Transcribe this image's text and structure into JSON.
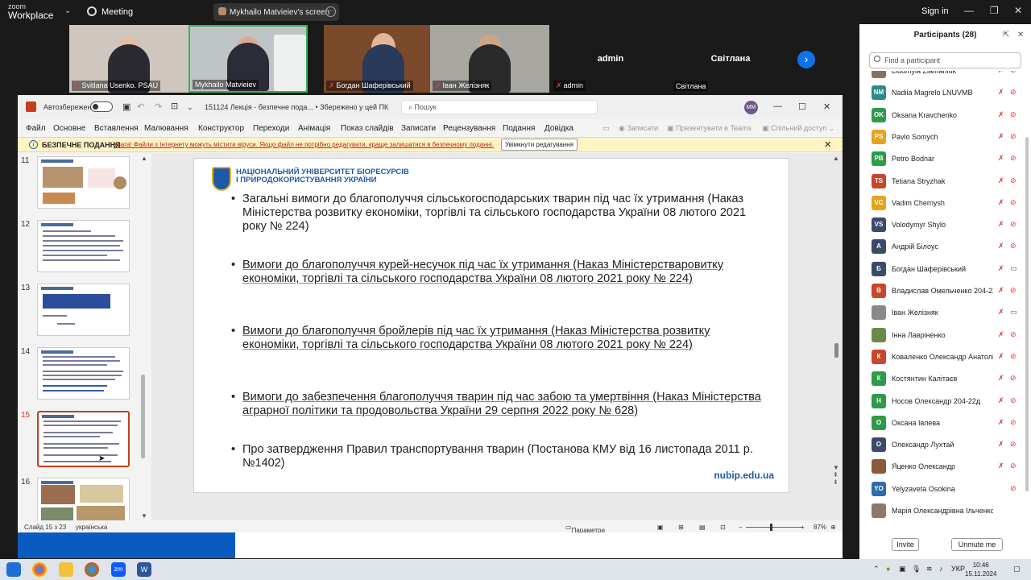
{
  "zoom": {
    "logo_top": "zoom",
    "logo_bottom": "Workplace",
    "meeting_label": "Meeting",
    "screen_label": "Mykhailo Matvieiev's screen",
    "signin": "Sign in"
  },
  "gallery": [
    {
      "name": "Svitlana Usenko. PSAU",
      "tile_text": ""
    },
    {
      "name": "Mykhailo Matvieiev",
      "tile_text": ""
    },
    {
      "name": "Богдан Шаферівський",
      "tile_text": ""
    },
    {
      "name": "Іван Желізняк",
      "tile_text": ""
    },
    {
      "name": "admin",
      "tile_text": "admin"
    },
    {
      "name": "Світлана",
      "tile_text": "Світлана"
    }
  ],
  "ppt": {
    "autosave_label": "Автозбереження",
    "doc_title": "151124 Лекція - безпечне пода...",
    "saved_label": "• Збережено у цей ПК",
    "search_placeholder": "Пошук",
    "user_initials": "MM",
    "menu": [
      "Файл",
      "Основне",
      "Вставлення",
      "Малювання",
      "Конструктор",
      "Переходи",
      "Анімація",
      "Показ слайдів",
      "Записати",
      "Рецензування",
      "Подання",
      "Довідка"
    ],
    "menu_right": [
      "Записати",
      "Презентувати в Teams",
      "Спільний доступ"
    ],
    "protected_title": "БЕЗПЕЧНЕ ПОДАННЯ",
    "protected_msg": "Увага! Файли з Інтернету можуть містити віруси. Якщо файл не потрібно редагувати, краще залишатися в безпечному поданні.",
    "enable_edit": "Увімкнути редагування",
    "thumbnails": [
      "11",
      "12",
      "13",
      "14",
      "15",
      "16"
    ],
    "selected_slide": "15",
    "slide": {
      "university": [
        "НАЦІОНАЛЬНИЙ УНІВЕРСИТЕТ БІОРЕСУРСІВ",
        "І ПРИРОДОКОРИСТУВАННЯ УКРАЇНИ"
      ],
      "bullets": [
        "Загальні вимоги до благополуччя сільськогосподарських тварин під час їх утримання (Наказ Міністерства розвитку економіки, торгівлі та сільського господарства України 08 лютого 2021 року № 224)",
        "Вимоги до благополуччя курей-несучок під час їх утримання (Наказ Міністерстваровитку економіки, торгівлі та сільського господарства України 08 лютого 2021 року № 224)",
        "Вимоги до благополуччя бройлерів під час їх утримання (Наказ Міністерства розвитку економіки, торгівлі та сільського господарства України 08 лютого 2021 року № 224)",
        "Вимоги до забезпечення благополуччя тварин під час забою та умертвіння (Наказ Міністерства аграрної політики та продовольства України 29 серпня 2022 року № 628)",
        "Про затвердження Правил транспортування тварин (Постанова КМУ від 16 листопада 2011 р. №1402)"
      ],
      "site": "nubip.edu.ua"
    },
    "status_slide": "Слайд 15 з 23",
    "status_lang": "українська",
    "status_view": "Параметри відображення",
    "zoom_level": "87%"
  },
  "participants": {
    "title": "Participants (28)",
    "search_placeholder": "Find a participant",
    "list": [
      {
        "name": "Liudmyla Ziamaniuk",
        "initials": "",
        "color": "#8a6f5a",
        "cam_on": false
      },
      {
        "name": "Nadiia Magrelo LNUVMB",
        "initials": "NM",
        "color": "#2e8a8a",
        "cam_on": false
      },
      {
        "name": "Oksana Kravchenko",
        "initials": "OK",
        "color": "#2e9a4a",
        "cam_on": false
      },
      {
        "name": "Pavlo Somych",
        "initials": "PS",
        "color": "#e8a21a",
        "cam_on": false
      },
      {
        "name": "Petro Bodnar",
        "initials": "PB",
        "color": "#2e9a4a",
        "cam_on": false
      },
      {
        "name": "Tetiana Stryzhak",
        "initials": "TS",
        "color": "#c8462a",
        "cam_on": false
      },
      {
        "name": "Vadim Chernysh",
        "initials": "VC",
        "color": "#e8a21a",
        "cam_on": false
      },
      {
        "name": "Volodymyr Shylo",
        "initials": "VS",
        "color": "#3a4a6a",
        "cam_on": false
      },
      {
        "name": "Андрій Білоус",
        "initials": "А",
        "color": "#3a4a6a",
        "cam_on": false
      },
      {
        "name": "Богдан Шаферівський",
        "initials": "Б",
        "color": "#3a4a6a",
        "cam_on": true
      },
      {
        "name": "Владислав Омельченко 204-22...",
        "initials": "В",
        "color": "#c8462a",
        "cam_on": false
      },
      {
        "name": "Іван Желізняк",
        "initials": "",
        "color": "#8a8a8a",
        "cam_on": true
      },
      {
        "name": "Інна Лавріненко",
        "initials": "",
        "color": "#6a8a4a",
        "cam_on": false
      },
      {
        "name": "Коваленко Олександр Анатолі...",
        "initials": "К",
        "color": "#c8462a",
        "cam_on": false
      },
      {
        "name": "Костянтин Калітаєв",
        "initials": "К",
        "color": "#2e9a4a",
        "cam_on": false
      },
      {
        "name": "Носов Олександр 204-22д",
        "initials": "Н",
        "color": "#2e9a4a",
        "cam_on": false
      },
      {
        "name": "Оксана Івлева",
        "initials": "О",
        "color": "#2e9a4a",
        "cam_on": false
      },
      {
        "name": "Олександр Лухтай",
        "initials": "О",
        "color": "#3a4a6a",
        "cam_on": false
      },
      {
        "name": "Яценко Олександр",
        "initials": "",
        "color": "#8a5a3a",
        "cam_on": false
      },
      {
        "name": "Yelyzaveta Osokina",
        "initials": "YO",
        "color": "#2e6ab0",
        "cam_on": false
      },
      {
        "name": "Марія Олександрівна Ільченко",
        "initials": "",
        "color": "#8a7a6a",
        "cam_on": null
      }
    ],
    "invite": "Invite",
    "unmute": "Unmute me"
  },
  "taskbar": {
    "lang": "УКР",
    "time": "10:46",
    "date": "15.11.2024"
  }
}
